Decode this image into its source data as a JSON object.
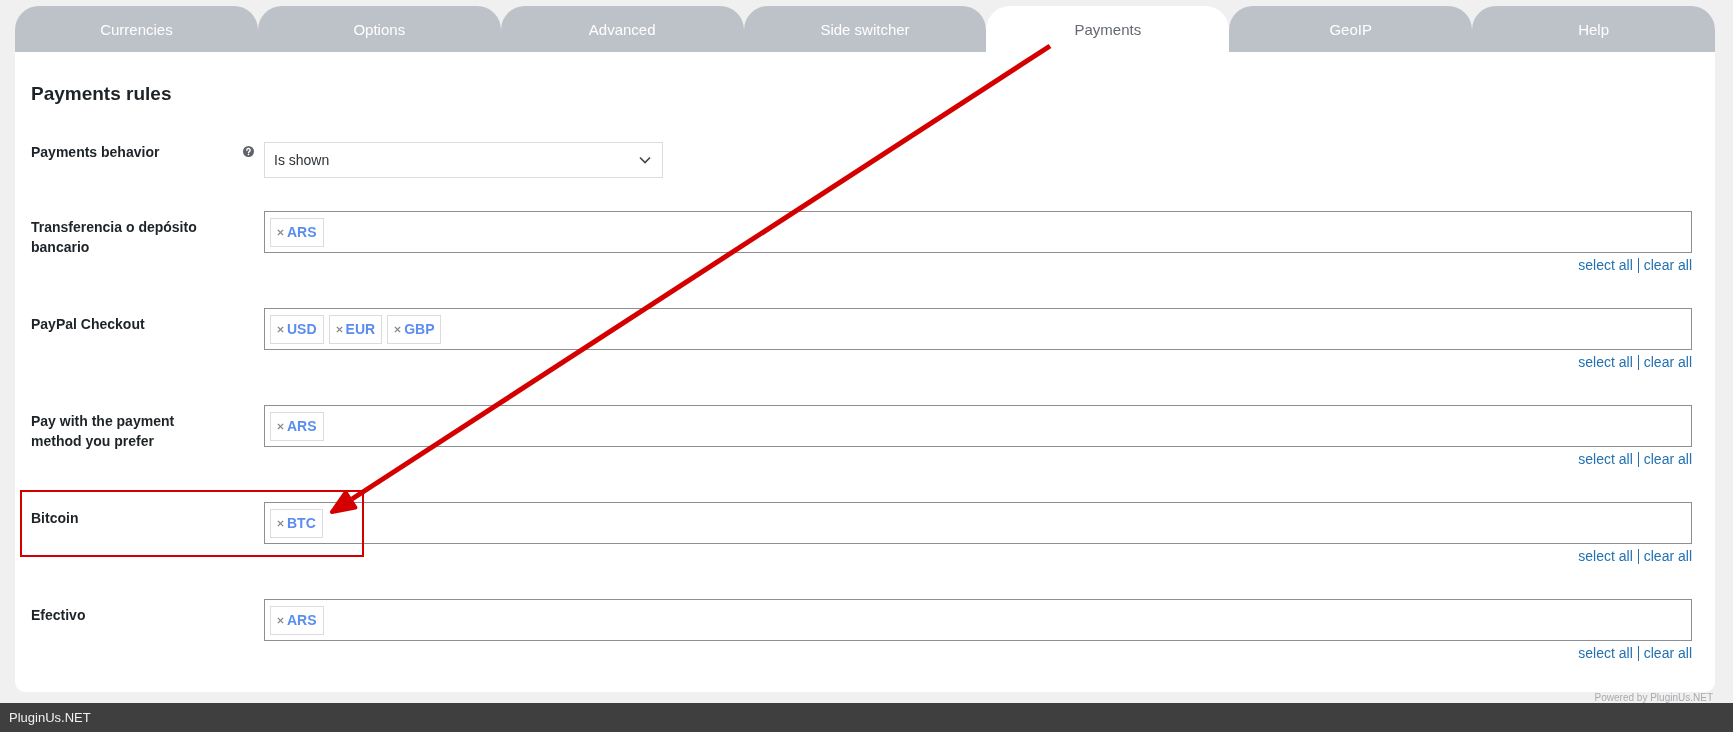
{
  "tabs": [
    {
      "label": "Currencies",
      "selected": false
    },
    {
      "label": "Options",
      "selected": false
    },
    {
      "label": "Advanced",
      "selected": false
    },
    {
      "label": "Side switcher",
      "selected": false
    },
    {
      "label": "Payments",
      "selected": true
    },
    {
      "label": "GeoIP",
      "selected": false
    },
    {
      "label": "Help",
      "selected": false
    }
  ],
  "panel": {
    "title": "Payments rules",
    "rows": [
      {
        "kind": "select",
        "label": "Payments behavior",
        "help": true,
        "value": "Is shown",
        "highlighted": false
      },
      {
        "kind": "multiselect",
        "label": "Transferencia o depósito bancario",
        "help": false,
        "tags": [
          "ARS"
        ],
        "select_all": "select all",
        "clear_all": "clear all",
        "highlighted": false
      },
      {
        "kind": "multiselect",
        "label": "PayPal Checkout",
        "help": false,
        "tags": [
          "USD",
          "EUR",
          "GBP"
        ],
        "select_all": "select all",
        "clear_all": "clear all",
        "highlighted": false
      },
      {
        "kind": "multiselect",
        "label": "Pay with the payment method you prefer",
        "help": false,
        "tags": [
          "ARS"
        ],
        "select_all": "select all",
        "clear_all": "clear all",
        "highlighted": false
      },
      {
        "kind": "multiselect",
        "label": "Bitcoin",
        "help": false,
        "tags": [
          "BTC"
        ],
        "select_all": "select all",
        "clear_all": "clear all",
        "highlighted": true
      },
      {
        "kind": "multiselect",
        "label": "Efectivo",
        "help": false,
        "tags": [
          "ARS"
        ],
        "select_all": "select all",
        "clear_all": "clear all",
        "highlighted": false
      }
    ]
  },
  "powered_by": "Powered by PluginUs.NET",
  "status_bar": {
    "text": "PluginUs.NET"
  }
}
